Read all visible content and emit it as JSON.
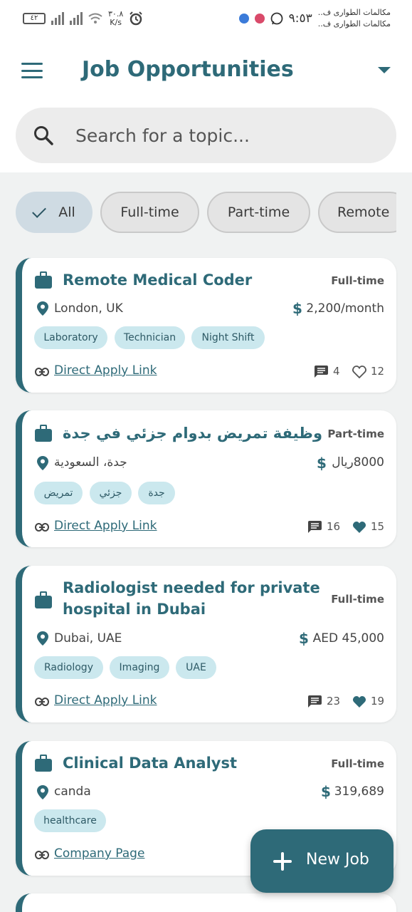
{
  "status_bar": {
    "battery": "٤٢",
    "speed_value": "٣٠.٨",
    "speed_unit": "K/s",
    "clock": "٩:٥٣",
    "notifications": [
      "مكالمات الطوارى ف..",
      "مكالمات الطوارى ف.."
    ]
  },
  "app_bar": {
    "title": "Job Opportunities"
  },
  "search": {
    "placeholder": "Search for a topic..."
  },
  "filters": [
    "All",
    "Full-time",
    "Part-time",
    "Remote"
  ],
  "jobs": [
    {
      "title": "Remote Medical Coder",
      "type": "Full-time",
      "location": "London, UK",
      "salary": "2,200/month",
      "tags": [
        "Laboratory",
        "Technician",
        "Night Shift"
      ],
      "link": "Direct Apply Link",
      "comments": "4",
      "likes": "12"
    },
    {
      "title": "وظيفة تمريض بدوام جزئي في جدة",
      "type": "Part-time",
      "location": "جدة، السعودية",
      "salary": "8000ريال",
      "tags": [
        "تمريض",
        "جزئي",
        "جدة"
      ],
      "link": "Direct Apply Link",
      "comments": "16",
      "likes": "15"
    },
    {
      "title_line1": "Radiologist needed for private",
      "title_line2": "hospital in Dubai",
      "type": "Full-time",
      "location": "Dubai, UAE",
      "salary": "AED 45,000",
      "tags": [
        "Radiology",
        "Imaging",
        "UAE"
      ],
      "link": "Direct Apply Link",
      "comments": "23",
      "likes": "19"
    },
    {
      "title": "Clinical Data Analyst",
      "type": "Full-time",
      "location": "canda",
      "salary": "319,689",
      "tags": [
        "healthcare"
      ],
      "link": "Company Page"
    }
  ],
  "fab": {
    "label": "New Job"
  },
  "colors": {
    "primary": "#2e6a78",
    "tag_bg": "#cbe8ee",
    "feed_bg": "#f0f2f2"
  }
}
